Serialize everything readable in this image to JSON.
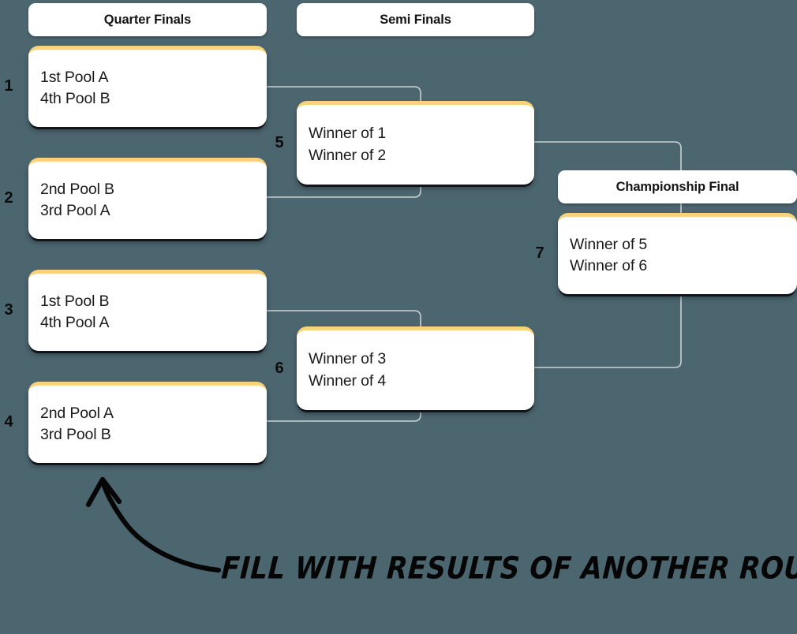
{
  "background_color": "#4c6670",
  "card_accent_color": "#f8d27c",
  "connector_color": "#c9d2d4",
  "rounds": [
    {
      "id": "quarter-finals",
      "label": "Quarter Finals"
    },
    {
      "id": "semi-finals",
      "label": "Semi Finals"
    },
    {
      "id": "championship-final",
      "label": "Championship Final"
    }
  ],
  "matches": [
    {
      "number": "1",
      "round": "quarter-finals",
      "top": "1st Pool A",
      "bottom": "4th Pool B"
    },
    {
      "number": "2",
      "round": "quarter-finals",
      "top": "2nd Pool B",
      "bottom": "3rd Pool A"
    },
    {
      "number": "3",
      "round": "quarter-finals",
      "top": "1st Pool B",
      "bottom": "4th Pool A"
    },
    {
      "number": "4",
      "round": "quarter-finals",
      "top": "2nd Pool A",
      "bottom": "3rd Pool B"
    },
    {
      "number": "5",
      "round": "semi-finals",
      "top": "Winner of 1",
      "bottom": "Winner of 2"
    },
    {
      "number": "6",
      "round": "semi-finals",
      "top": "Winner of 3",
      "bottom": "Winner of 4"
    },
    {
      "number": "7",
      "round": "championship-final",
      "top": "Winner of 5",
      "bottom": "Winner of 6"
    }
  ],
  "annotation": {
    "text": "FILL WITH RESULTS OF ANOTHER ROUND!"
  }
}
